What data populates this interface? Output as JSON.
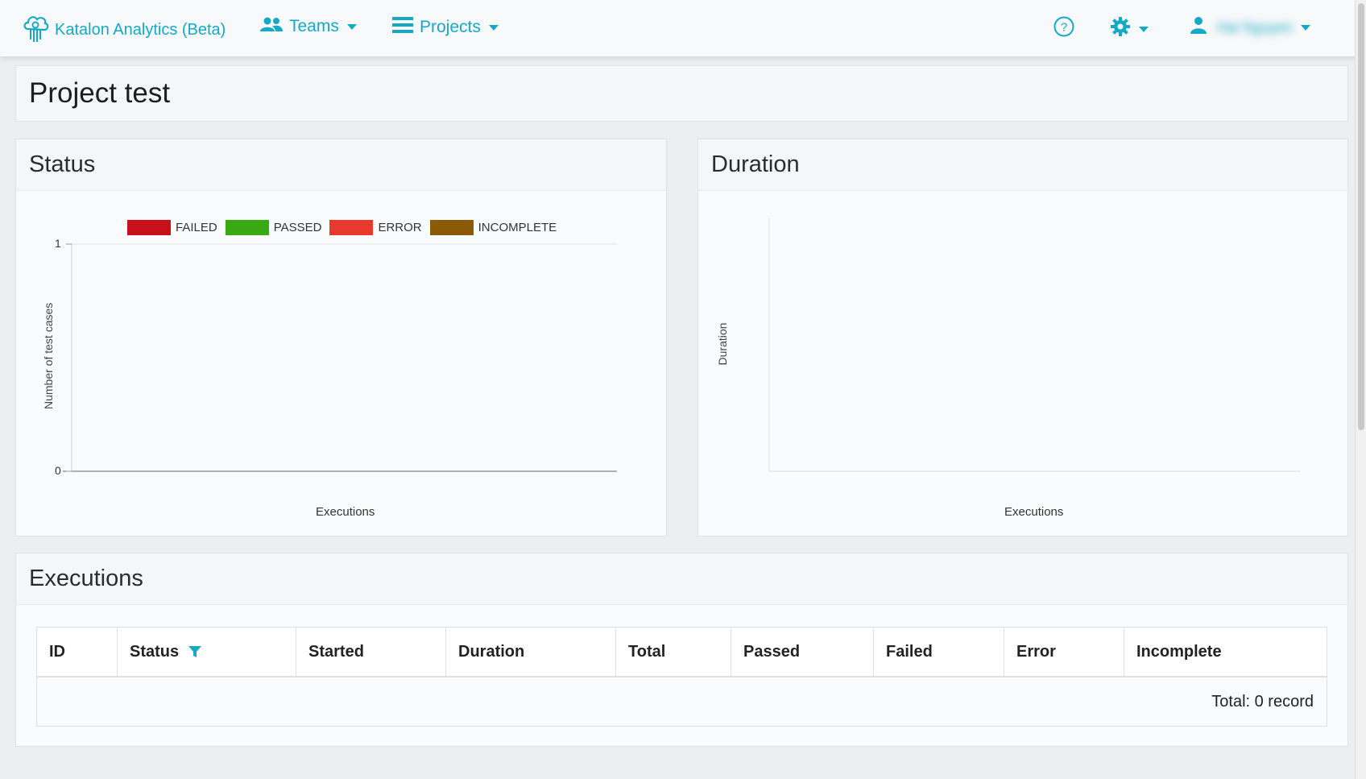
{
  "nav": {
    "brand": "Katalon Analytics (Beta)",
    "teams_label": "Teams",
    "projects_label": "Projects",
    "user_name": "Hai Nguyen"
  },
  "page": {
    "title": "Project test"
  },
  "status_panel": {
    "title": "Status",
    "chart_data": {
      "type": "bar",
      "legend": [
        {
          "name": "FAILED",
          "color": "#c8101a"
        },
        {
          "name": "PASSED",
          "color": "#3aa812"
        },
        {
          "name": "ERROR",
          "color": "#e8392e"
        },
        {
          "name": "INCOMPLETE",
          "color": "#8a5a06"
        }
      ],
      "categories": [],
      "series": [],
      "xlabel": "Executions",
      "ylabel": "Number of test cases",
      "ylim": [
        0,
        1
      ],
      "yticks": [
        "1",
        "0"
      ],
      "legend_position": "top"
    }
  },
  "duration_panel": {
    "title": "Duration",
    "chart_data": {
      "type": "line",
      "series": [],
      "xlabel": "Executions",
      "ylabel": "Duration"
    }
  },
  "executions": {
    "title": "Executions",
    "columns": [
      "ID",
      "Status",
      "Started",
      "Duration",
      "Total",
      "Passed",
      "Failed",
      "Error",
      "Incomplete"
    ],
    "rows": [],
    "total_text": "Total: 0 record"
  },
  "colors": {
    "accent": "#16a9c6"
  }
}
